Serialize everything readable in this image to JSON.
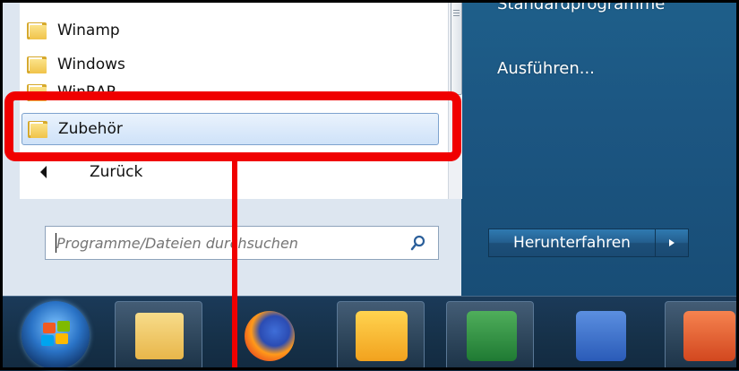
{
  "start_menu": {
    "programs": [
      {
        "label": "Winamp"
      },
      {
        "label": "Windows"
      },
      {
        "label": "WinRAR"
      },
      {
        "label": "Zubehör"
      }
    ],
    "back_label": "Zurück",
    "search_placeholder": "Programme/Dateien durchsuchen",
    "right_items": [
      "Standardprogramme",
      "Ausführen..."
    ],
    "shutdown_label": "Herunterfahren"
  },
  "taskbar": {
    "apps": [
      {
        "name": "explorer-icon"
      },
      {
        "name": "firefox-icon"
      },
      {
        "name": "outlook-icon"
      },
      {
        "name": "excel-icon"
      },
      {
        "name": "word-icon"
      },
      {
        "name": "powerpoint-icon"
      }
    ]
  },
  "colors": {
    "highlight": "#f00000",
    "start_menu_right": "#1c5682",
    "taskbar": "#163149"
  }
}
